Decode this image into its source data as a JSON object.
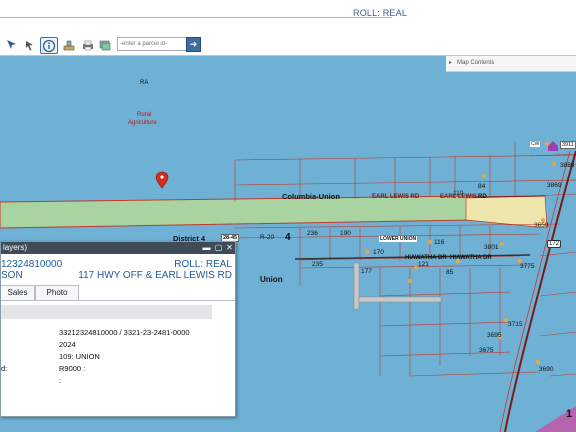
{
  "header": {
    "roll_label": "ROLL: REAL"
  },
  "toolbar": {
    "parcel_placeholder": "-enter a parcel id-",
    "tools": [
      "select-arrow",
      "pan-cursor",
      "identify-info",
      "measure",
      "print",
      "layers"
    ]
  },
  "map": {
    "contents_label": "Map Contents",
    "labels": {
      "ra": "RA",
      "rural": "Rural",
      "agriculture": "Agriculture",
      "columbia_union": "Columbia-Union",
      "earl_lewis_1": "EARL LEWIS RD",
      "earl_lewis_2": "EARL LEWIS",
      "rd": "RD",
      "district": "District 4",
      "r20": "R-20",
      "four": "4",
      "lower_union": "LOWER UNION",
      "hiawatha_1": "HIAWATHA DR",
      "hiawatha_2": "HIAWATHA DR",
      "union": "Union",
      "one": "1",
      "badge_2845": "28-45",
      "badge_3911": "3911",
      "badge_cw": "CW",
      "badge_172": "172"
    },
    "parcel_numbers": [
      {
        "id": "n3889",
        "text": "3889"
      },
      {
        "id": "n3869",
        "text": "3869"
      },
      {
        "id": "n84",
        "text": "84"
      },
      {
        "id": "n110",
        "text": "110"
      },
      {
        "id": "n236",
        "text": "236"
      },
      {
        "id": "n190",
        "text": "190"
      },
      {
        "id": "n3659",
        "text": "3659"
      },
      {
        "id": "n116",
        "text": "116"
      },
      {
        "id": "n3801",
        "text": "3801"
      },
      {
        "id": "n170",
        "text": "170"
      },
      {
        "id": "n235",
        "text": "235"
      },
      {
        "id": "n177",
        "text": "177"
      },
      {
        "id": "n121",
        "text": "121"
      },
      {
        "id": "n85",
        "text": "85"
      },
      {
        "id": "n3775",
        "text": "3775"
      },
      {
        "id": "n3715",
        "text": "3715"
      },
      {
        "id": "n3695",
        "text": "3695"
      },
      {
        "id": "n3675",
        "text": "3675"
      },
      {
        "id": "n3690",
        "text": "3690"
      }
    ]
  },
  "popup": {
    "title": "layers)",
    "parcel_id": "12324810000",
    "roll": "ROLL: REAL",
    "owner": "SON",
    "address": "117 HWY OFF & EARL LEWIS RD",
    "tabs": [
      "Sales",
      "Photo"
    ],
    "rows": [
      {
        "label": "",
        "value": "33212324810000 / 3321-23-2481-0000"
      },
      {
        "label": "",
        "value": "2024"
      },
      {
        "label": "",
        "value": "109: UNION"
      },
      {
        "label": "d:",
        "value": "R9000 :"
      },
      {
        "label": "",
        "value": ":"
      }
    ]
  }
}
